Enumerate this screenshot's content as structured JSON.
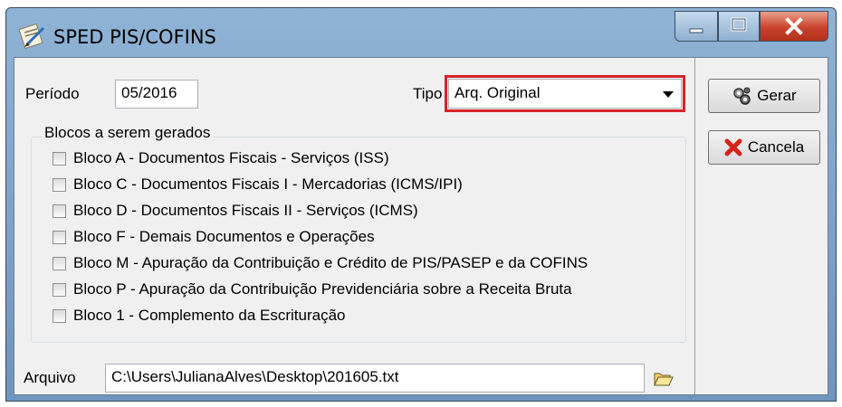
{
  "window": {
    "title": "SPED PIS/COFINS"
  },
  "icons": {
    "app": "sped-app-icon",
    "minimize": "minimize-icon",
    "maximize": "maximize-icon",
    "close": "close-icon",
    "gerar": "gears-icon",
    "cancela": "red-x-icon",
    "folder": "folder-open-icon"
  },
  "colors": {
    "highlight": "#d8232a",
    "titlebar": "#7fa3c9",
    "close_button": "#c8432c"
  },
  "form": {
    "periodo_label": "Período",
    "periodo_value": "05/2016",
    "tipo_label": "Tipo",
    "tipo_value": "Arq. Original",
    "group_title": "Blocos a serem gerados",
    "blocks": [
      {
        "label": "Bloco A - Documentos Fiscais - Serviços (ISS)",
        "checked": false
      },
      {
        "label": "Bloco C - Documentos Fiscais I - Mercadorias (ICMS/IPI)",
        "checked": false
      },
      {
        "label": "Bloco D - Documentos Fiscais II - Serviços (ICMS)",
        "checked": false
      },
      {
        "label": "Bloco F - Demais Documentos e Operações",
        "checked": false
      },
      {
        "label": "Bloco M - Apuração da Contribuição e Crédito de PIS/PASEP e da COFINS",
        "checked": false
      },
      {
        "label": "Bloco P - Apuração da Contribuição Previdenciária sobre a Receita Bruta",
        "checked": false
      },
      {
        "label": "Bloco 1 - Complemento da Escrituração",
        "checked": false
      }
    ],
    "arquivo_label": "Arquivo",
    "arquivo_value": "C:\\Users\\JulianaAlves\\Desktop\\201605.txt"
  },
  "buttons": {
    "gerar": "Gerar",
    "cancela": "Cancela"
  }
}
